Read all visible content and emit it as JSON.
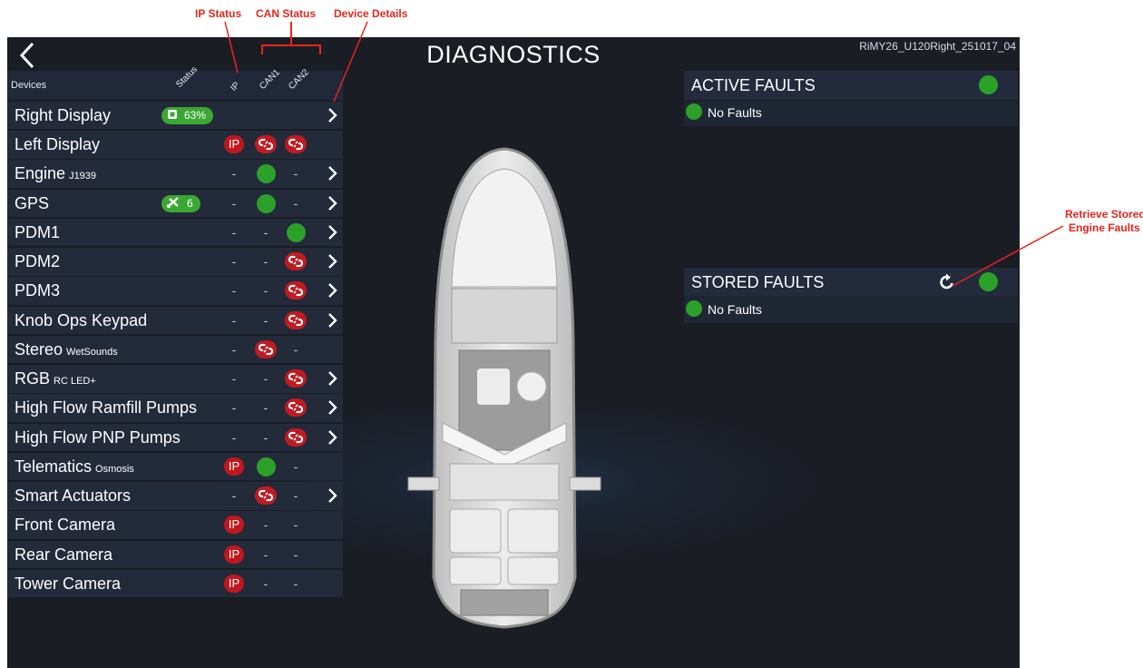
{
  "annotations": {
    "ip_status": "IP Status",
    "can_status": "CAN Status",
    "device_details": "Device Details",
    "retrieve_stored_1": "Retrieve Stored",
    "retrieve_stored_2": "Engine Faults"
  },
  "header": {
    "title": "DIAGNOSTICS",
    "build": "RiMY26_U120Right_251017_04"
  },
  "columns": {
    "devices": "Devices",
    "status": "Status",
    "ip": "IP",
    "can1": "CAN1",
    "can2": "CAN2"
  },
  "devices": [
    {
      "name": "Right Display",
      "sub": "",
      "status": {
        "type": "cpu",
        "text": "63%"
      },
      "ip": "",
      "can1": "",
      "can2": "",
      "details": true
    },
    {
      "name": "Left Display",
      "sub": "",
      "status": null,
      "ip": "ip-error",
      "can1": "link-error",
      "can2": "link-error",
      "details": false
    },
    {
      "name": "Engine",
      "sub": "J1939",
      "status": null,
      "ip": "-",
      "can1": "ok",
      "can2": "-",
      "details": true
    },
    {
      "name": "GPS",
      "sub": "",
      "status": {
        "type": "satellite",
        "text": "6"
      },
      "ip": "-",
      "can1": "ok",
      "can2": "-",
      "details": true
    },
    {
      "name": "PDM1",
      "sub": "",
      "status": null,
      "ip": "-",
      "can1": "-",
      "can2": "ok",
      "details": true
    },
    {
      "name": "PDM2",
      "sub": "",
      "status": null,
      "ip": "-",
      "can1": "-",
      "can2": "link-error",
      "details": true
    },
    {
      "name": "PDM3",
      "sub": "",
      "status": null,
      "ip": "-",
      "can1": "-",
      "can2": "link-error",
      "details": true
    },
    {
      "name": "Knob Ops Keypad",
      "sub": "",
      "status": null,
      "ip": "-",
      "can1": "-",
      "can2": "link-error",
      "details": true
    },
    {
      "name": "Stereo",
      "sub": "WetSounds",
      "status": null,
      "ip": "-",
      "can1": "link-error",
      "can2": "-",
      "details": false
    },
    {
      "name": "RGB",
      "sub": "RC LED+",
      "status": null,
      "ip": "-",
      "can1": "-",
      "can2": "link-error",
      "details": true
    },
    {
      "name": "High Flow Ramfill Pumps",
      "sub": "",
      "status": null,
      "ip": "-",
      "can1": "-",
      "can2": "link-error",
      "details": true
    },
    {
      "name": "High Flow PNP Pumps",
      "sub": "",
      "status": null,
      "ip": "-",
      "can1": "-",
      "can2": "link-error",
      "details": true
    },
    {
      "name": "Telematics",
      "sub": "Osmosis",
      "status": null,
      "ip": "ip-error",
      "can1": "ok",
      "can2": "-",
      "details": false
    },
    {
      "name": "Smart Actuators",
      "sub": "",
      "status": null,
      "ip": "-",
      "can1": "link-error",
      "can2": "-",
      "details": true
    },
    {
      "name": "Front Camera",
      "sub": "",
      "status": null,
      "ip": "ip-error",
      "can1": "-",
      "can2": "-",
      "details": false
    },
    {
      "name": "Rear Camera",
      "sub": "",
      "status": null,
      "ip": "ip-error",
      "can1": "-",
      "can2": "-",
      "details": false
    },
    {
      "name": "Tower Camera",
      "sub": "",
      "status": null,
      "ip": "ip-error",
      "can1": "-",
      "can2": "-",
      "details": false
    }
  ],
  "ip_label": "IP",
  "dash": "-",
  "active_faults": {
    "title": "ACTIVE FAULTS",
    "message": "No Faults"
  },
  "stored_faults": {
    "title": "STORED FAULTS",
    "message": "No Faults"
  },
  "colors": {
    "ok": "#2ca12a",
    "error": "#c0181e",
    "annotation": "#e8251a",
    "background": "#1b1d25"
  }
}
